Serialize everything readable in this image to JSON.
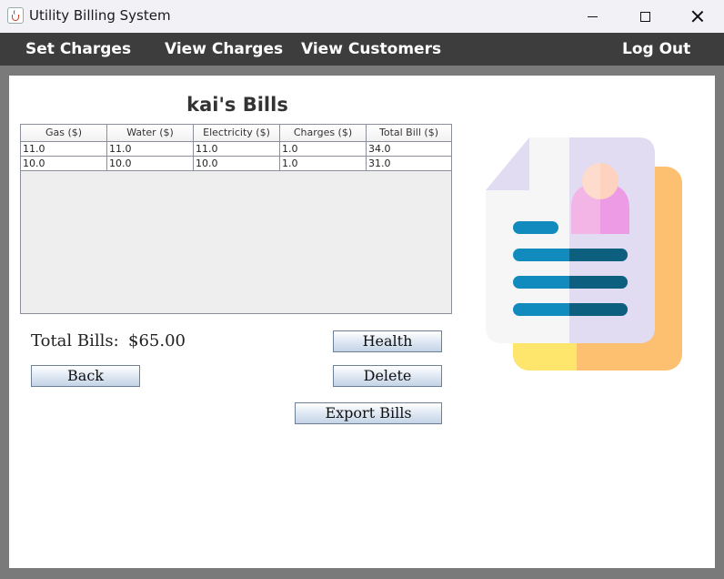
{
  "window": {
    "title": "Utility Billing System",
    "icon": "java-cup-icon"
  },
  "menu": {
    "items": [
      {
        "label": "Set Charges"
      },
      {
        "label": "View Charges"
      },
      {
        "label": "View Customers"
      },
      {
        "label": "Log Out"
      }
    ]
  },
  "page": {
    "title": "kai's Bills"
  },
  "table": {
    "columns": [
      "Gas ($)",
      "Water ($)",
      "Electricity ($)",
      "Charges ($)",
      "Total Bill ($)"
    ],
    "rows": [
      [
        "11.0",
        "11.0",
        "11.0",
        "1.0",
        "34.0"
      ],
      [
        "10.0",
        "10.0",
        "10.0",
        "1.0",
        "31.0"
      ]
    ]
  },
  "summary": {
    "total_label": "Total Bills:",
    "total_value": "$65.00"
  },
  "buttons": {
    "health": "Health",
    "back": "Back",
    "delete": "Delete",
    "export": "Export Bills"
  },
  "illustration": {
    "icon": "bill-document-icon",
    "colors": {
      "back_page": "#fdc070",
      "yellow_strip": "#fde66b",
      "page_light": "#f6f6f6",
      "page_lavender": "#e2dcf3",
      "avatar_head": "#fdd3c0",
      "avatar_body": "#ee9be6",
      "line_blue": "#118bbd",
      "line_dark": "#0d5f80"
    }
  }
}
